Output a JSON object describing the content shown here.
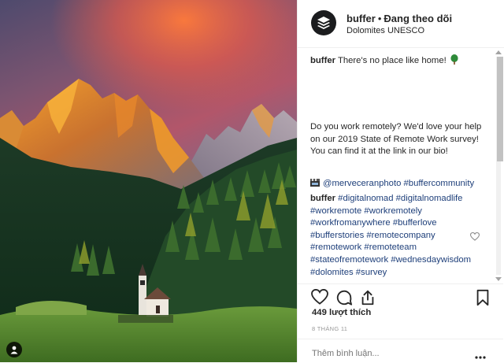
{
  "post": {
    "author": "buffer",
    "follow_status": "Đang theo dõi",
    "separator": "•",
    "location": "Dolomites UNESCO"
  },
  "caption": {
    "user": "buffer",
    "text": "There's no place like home!",
    "emoji_icon": "deciduous-tree-icon",
    "remote_text": "Do you work remotely? We'd love your help on our 2019 State of Remote Work survey! You can find it at the link in our bio!",
    "mentions_icon": "clapper-board-icon",
    "mentions": "@merveceranphoto #buffercommunity",
    "tags_user": "buffer",
    "hashtags": "#digitalnomad #digitalnomadlife #workremote #workremotely #workfromanywhere #bufferlove #bufferstories #remotecompany #remotework #remoteteam #stateofremotework #wednesdaywisdom #dolomites #survey"
  },
  "stats": {
    "likes": "449 lượt thích",
    "date": "8 THÁNG 11"
  },
  "comment": {
    "placeholder": "Thêm bình luận..."
  },
  "icons": {
    "like": "heart-icon",
    "comment": "comment-bubble-icon",
    "share": "share-icon",
    "save": "bookmark-icon",
    "more": "more-options-icon",
    "tag": "user-tag-icon"
  },
  "colors": {
    "link": "#1e3f7a",
    "text": "#262626",
    "muted": "#999999",
    "border": "#efefef"
  }
}
